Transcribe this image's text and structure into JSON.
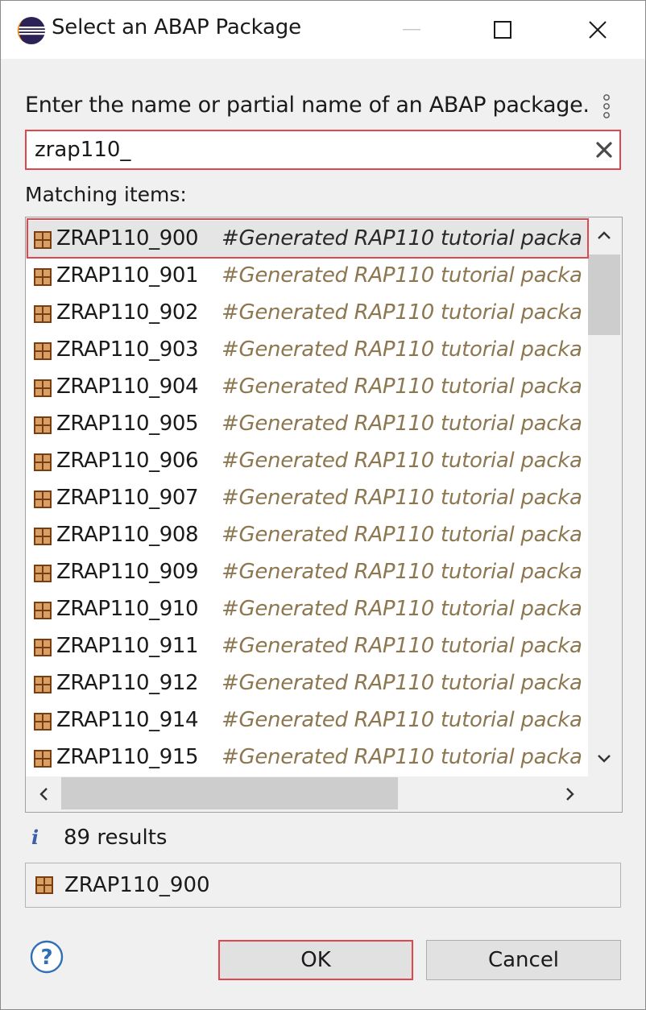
{
  "window": {
    "title": "Select an ABAP Package",
    "icon": "eclipse-icon"
  },
  "prompt": "Enter the name or partial name of an ABAP package.",
  "search": {
    "value": "zrap110_"
  },
  "matching_label": "Matching items:",
  "items": [
    {
      "name": "ZRAP110_900",
      "desc": "#Generated RAP110  tutorial packa"
    },
    {
      "name": "ZRAP110_901",
      "desc": "#Generated RAP110  tutorial packa"
    },
    {
      "name": "ZRAP110_902",
      "desc": "#Generated RAP110  tutorial packa"
    },
    {
      "name": "ZRAP110_903",
      "desc": "#Generated RAP110  tutorial packa"
    },
    {
      "name": "ZRAP110_904",
      "desc": "#Generated RAP110  tutorial packa"
    },
    {
      "name": "ZRAP110_905",
      "desc": "#Generated RAP110  tutorial packa"
    },
    {
      "name": "ZRAP110_906",
      "desc": "#Generated RAP110  tutorial packa"
    },
    {
      "name": "ZRAP110_907",
      "desc": "#Generated RAP110  tutorial packa"
    },
    {
      "name": "ZRAP110_908",
      "desc": "#Generated RAP110  tutorial packa"
    },
    {
      "name": "ZRAP110_909",
      "desc": "#Generated RAP110  tutorial packa"
    },
    {
      "name": "ZRAP110_910",
      "desc": "#Generated RAP110  tutorial packa"
    },
    {
      "name": "ZRAP110_911",
      "desc": "#Generated RAP110  tutorial packa"
    },
    {
      "name": "ZRAP110_912",
      "desc": "#Generated RAP110  tutorial packa"
    },
    {
      "name": "ZRAP110_914",
      "desc": "#Generated RAP110  tutorial packa"
    },
    {
      "name": "ZRAP110_915",
      "desc": "#Generated RAP110  tutorial packa"
    }
  ],
  "selected_index": 0,
  "results_text": "89 results",
  "selection": "ZRAP110_900",
  "buttons": {
    "ok": "OK",
    "cancel": "Cancel"
  },
  "colors": {
    "highlight": "#e0474c",
    "description": "#8c7750",
    "package_icon": "#a0522d"
  }
}
